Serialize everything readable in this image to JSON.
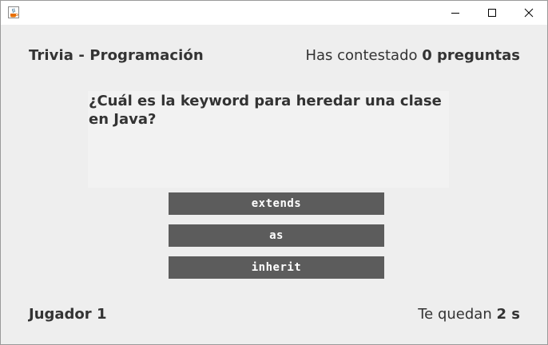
{
  "window": {
    "minimize_icon": "minimize-icon",
    "maximize_icon": "maximize-icon",
    "close_icon": "close-icon",
    "app_icon": "java-cup-icon"
  },
  "header": {
    "title": "Trivia - Programación",
    "answered_prefix": "Has contestado",
    "answered_count": "0 preguntas"
  },
  "question": {
    "text": "¿Cuál es la keyword para heredar una clase en Java?"
  },
  "answers": [
    {
      "label": "extends"
    },
    {
      "label": "as"
    },
    {
      "label": "inherit"
    }
  ],
  "footer": {
    "player": "Jugador 1",
    "time_prefix": "Te quedan",
    "time_value": "2 s"
  },
  "colors": {
    "background": "#eeeeee",
    "button_bg": "#5c5c5c",
    "button_text": "#ffffff",
    "text": "#333333"
  }
}
